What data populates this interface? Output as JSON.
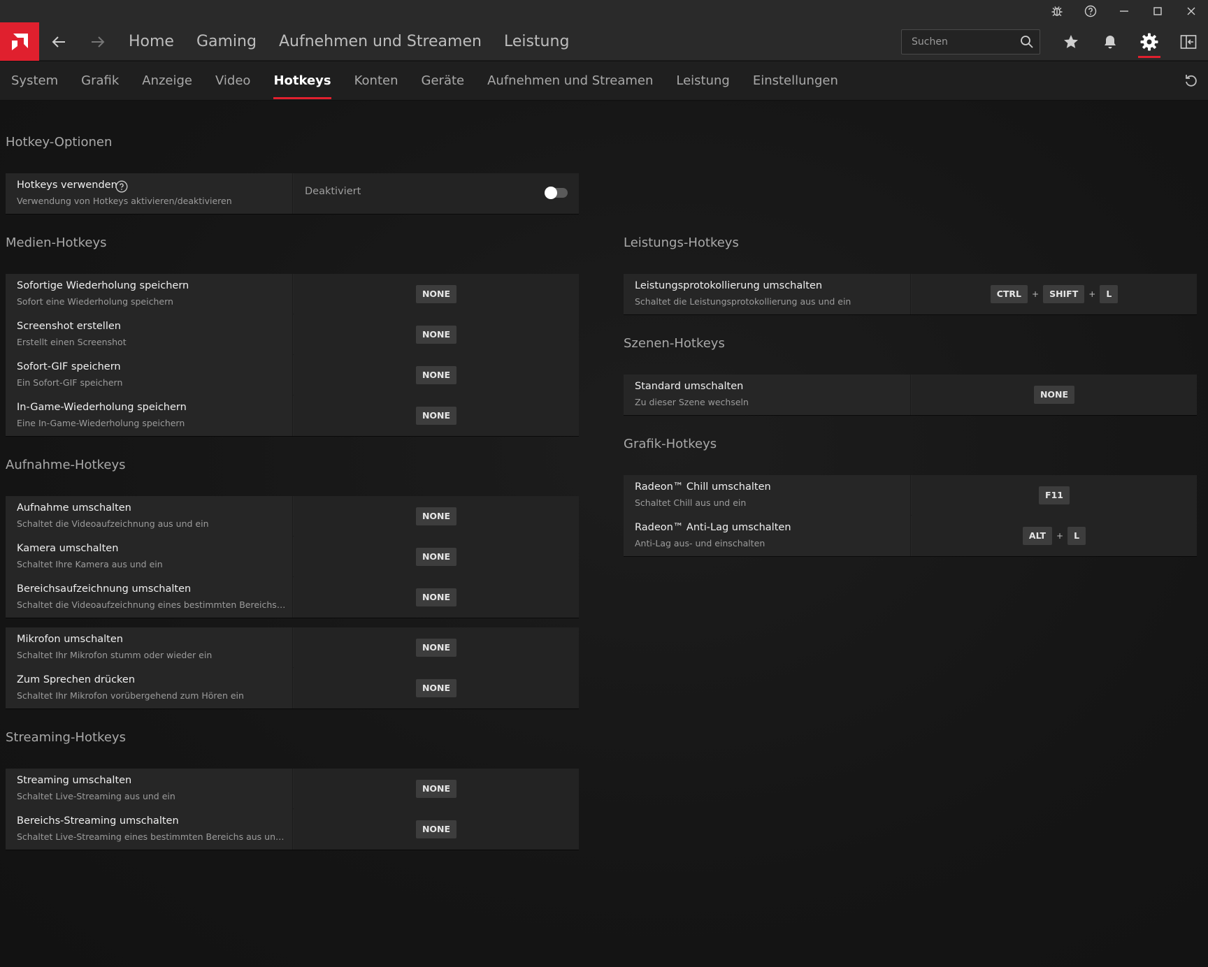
{
  "window": {
    "controls": [
      {
        "name": "bug-report-icon"
      },
      {
        "name": "help-icon"
      },
      {
        "name": "minimize-icon"
      },
      {
        "name": "maximize-icon"
      },
      {
        "name": "close-icon"
      }
    ]
  },
  "main_nav": {
    "tabs": [
      "Home",
      "Gaming",
      "Aufnehmen und Streamen",
      "Leistung"
    ],
    "search_placeholder": "Suchen"
  },
  "sub_nav": {
    "tabs": [
      "System",
      "Grafik",
      "Anzeige",
      "Video",
      "Hotkeys",
      "Konten",
      "Geräte",
      "Aufnehmen und Streamen",
      "Leistung",
      "Einstellungen"
    ],
    "active_index": 4
  },
  "colors": {
    "accent": "#e0202e",
    "background": "#141414",
    "card": "#262626"
  },
  "hotkey_options": {
    "title": "Hotkey-Optionen",
    "row": {
      "title": "Hotkeys verwenden",
      "desc": "Verwendung von Hotkeys aktivieren/deaktivieren",
      "state_label": "Deaktiviert",
      "enabled": false
    }
  },
  "media": {
    "title": "Medien-Hotkeys",
    "rows": [
      {
        "title": "Sofortige Wiederholung speichern",
        "desc": "Sofort eine Wiederholung speichern",
        "keys": [
          "NONE"
        ]
      },
      {
        "title": "Screenshot erstellen",
        "desc": "Erstellt einen Screenshot",
        "keys": [
          "NONE"
        ]
      },
      {
        "title": "Sofort-GIF speichern",
        "desc": "Ein Sofort-GIF speichern",
        "keys": [
          "NONE"
        ]
      },
      {
        "title": "In-Game-Wiederholung speichern",
        "desc": "Eine In-Game-Wiederholung speichern",
        "keys": [
          "NONE"
        ]
      }
    ]
  },
  "recording": {
    "title": "Aufnahme-Hotkeys",
    "groups": [
      [
        {
          "title": "Aufnahme umschalten",
          "desc": "Schaltet die Videoaufzeichnung aus und ein",
          "keys": [
            "NONE"
          ]
        },
        {
          "title": "Kamera umschalten",
          "desc": "Schaltet Ihre Kamera aus und ein",
          "keys": [
            "NONE"
          ]
        },
        {
          "title": "Bereichsaufzeichnung umschalten",
          "desc": "Schaltet die Videoaufzeichnung eines bestimmten Bereichs aus ...",
          "keys": [
            "NONE"
          ]
        }
      ],
      [
        {
          "title": "Mikrofon umschalten",
          "desc": "Schaltet Ihr Mikrofon stumm oder wieder ein",
          "keys": [
            "NONE"
          ]
        },
        {
          "title": "Zum Sprechen drücken",
          "desc": "Schaltet Ihr Mikrofon vorübergehend zum Hören ein",
          "keys": [
            "NONE"
          ]
        }
      ]
    ]
  },
  "streaming": {
    "title": "Streaming-Hotkeys",
    "rows": [
      {
        "title": "Streaming umschalten",
        "desc": "Schaltet Live-Streaming aus und ein",
        "keys": [
          "NONE"
        ]
      },
      {
        "title": "Bereichs-Streaming umschalten",
        "desc": "Schaltet Live-Streaming eines bestimmten Bereichs aus und ein",
        "keys": [
          "NONE"
        ]
      }
    ]
  },
  "performance": {
    "title": "Leistungs-Hotkeys",
    "rows": [
      {
        "title": "Leistungsprotokollierung umschalten",
        "desc": "Schaltet die Leistungsprotokollierung aus und ein",
        "keys": [
          "CTRL",
          "SHIFT",
          "L"
        ]
      }
    ]
  },
  "scenes": {
    "title": "Szenen-Hotkeys",
    "rows": [
      {
        "title": "Standard umschalten",
        "desc": "Zu dieser Szene wechseln",
        "keys": [
          "NONE"
        ]
      }
    ]
  },
  "graphics": {
    "title": "Grafik-Hotkeys",
    "rows": [
      {
        "title": "Radeon™ Chill umschalten",
        "desc": "Schaltet Chill aus und ein",
        "keys": [
          "F11"
        ]
      },
      {
        "title": "Radeon™ Anti-Lag umschalten",
        "desc": "Anti-Lag aus- und einschalten",
        "keys": [
          "ALT",
          "L"
        ]
      }
    ]
  }
}
